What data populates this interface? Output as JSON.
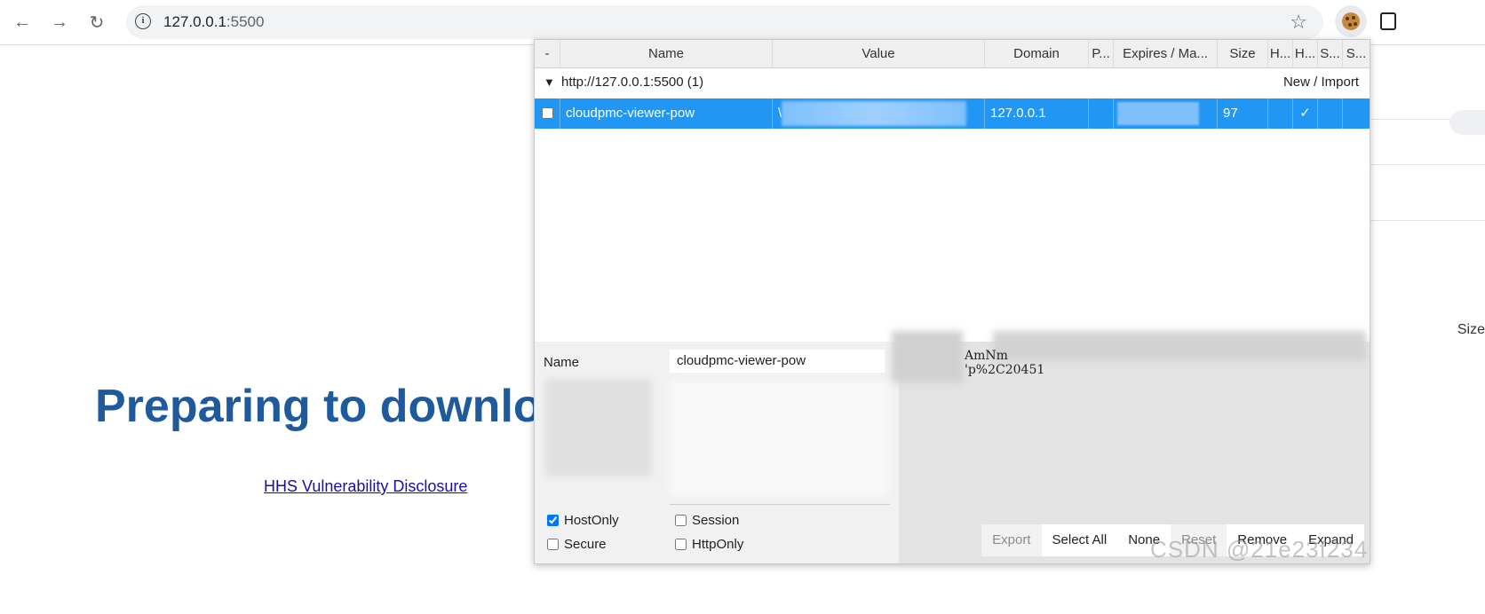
{
  "browser": {
    "url_host": "127.0.0.1",
    "url_port": ":5500",
    "back_icon": "←",
    "forward_icon": "→",
    "reload_icon": "↻",
    "info_icon": "i",
    "star_icon": "☆"
  },
  "page": {
    "heading": "Preparing to downlo",
    "link": "HHS Vulnerability Disclosure",
    "side_size_label": "Size"
  },
  "cookie_editor": {
    "columns": [
      "-",
      "Name",
      "Value",
      "Domain",
      "P...",
      "Expires / Ma...",
      "Size",
      "H...",
      "H...",
      "S...",
      "S..."
    ],
    "group": {
      "expand_icon": "▼",
      "title": "http://127.0.0.1:5500 (1)",
      "actions": "New / Import"
    },
    "row": {
      "name": "cloudpmc-viewer-pow",
      "value_prefix": "\\",
      "domain": "127.0.0.1",
      "size": "97",
      "httponly_check": "✓"
    },
    "editor": {
      "name_label": "Name",
      "name_value": "cloudpmc-viewer-pow",
      "value_text_line1": "AmNm",
      "value_text_line2": "'p%2C20451",
      "hostonly_label": "HostOnly",
      "hostonly_checked": true,
      "session_label": "Session",
      "session_checked": false,
      "secure_label": "Secure",
      "secure_checked": false,
      "httponly_label": "HttpOnly",
      "httponly_checked": false
    },
    "buttons": {
      "export": "Export",
      "select_all": "Select All",
      "none": "None",
      "reset": "Reset",
      "remove": "Remove",
      "expand": "Expand"
    }
  },
  "watermark": "CSDN @21e23f234",
  "colors": {
    "selected_row": "#2196f3",
    "heading": "#1f5a9c",
    "link": "#1a0dab"
  }
}
